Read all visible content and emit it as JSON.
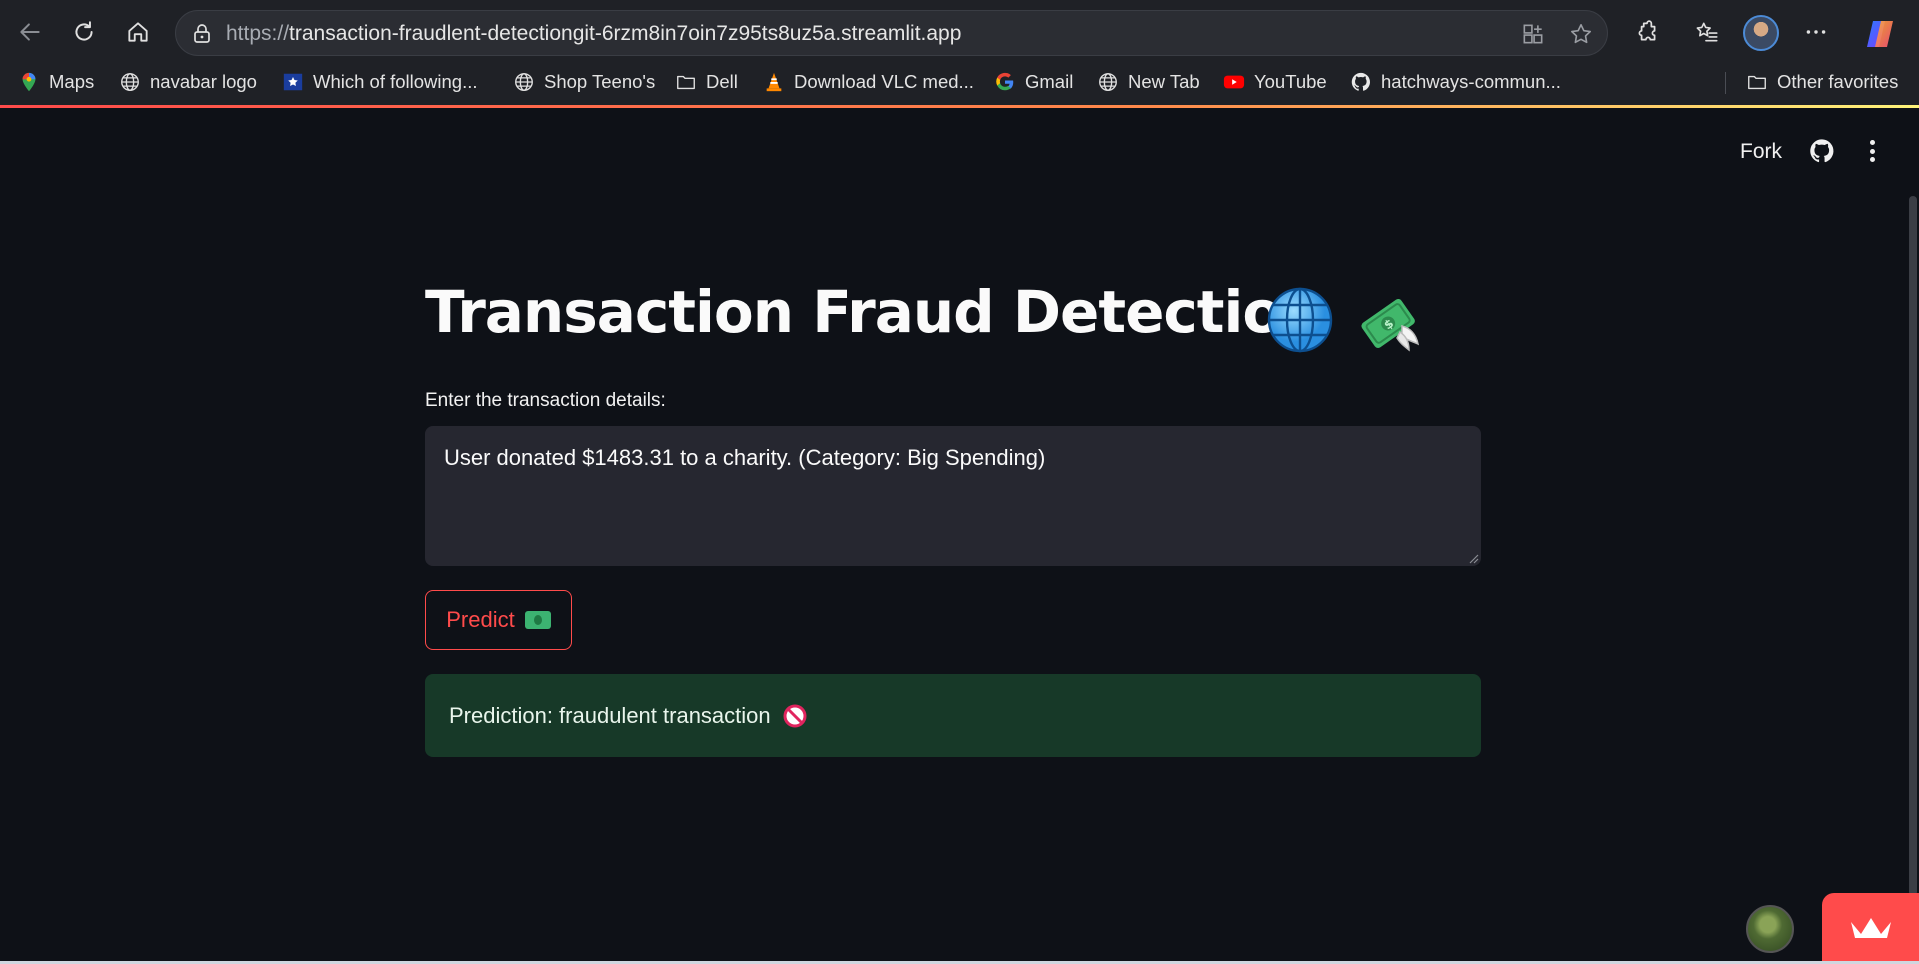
{
  "browser": {
    "url_protocol": "https://",
    "url_rest": "transaction-fraudlent-detectiongit-6rzm8in7oin7z95ts8uz5a.streamlit.app",
    "bookmarks": [
      {
        "label": "Maps",
        "icon": "maps-pin-icon"
      },
      {
        "label": "navabar logo",
        "icon": "globe-icon"
      },
      {
        "label": "Which of following...",
        "icon": "star-flag-icon"
      },
      {
        "label": "Shop Teeno's",
        "icon": "globe-icon"
      },
      {
        "label": "Dell",
        "icon": "folder-icon"
      },
      {
        "label": "Download VLC med...",
        "icon": "vlc-cone-icon"
      },
      {
        "label": "Gmail",
        "icon": "google-icon"
      },
      {
        "label": "New Tab",
        "icon": "globe-icon"
      },
      {
        "label": "YouTube",
        "icon": "youtube-icon"
      },
      {
        "label": "hatchways-commun...",
        "icon": "github-icon"
      }
    ],
    "other_favorites": "Other favorites"
  },
  "app": {
    "fork_label": "Fork",
    "title": "Transaction Fraud Detection",
    "input_label": "Enter the transaction details:",
    "input_value": "User donated $1483.31 to a charity. (Category: Big Spending)",
    "predict_label": "Predict",
    "result_text": "Prediction: fraudulent transaction"
  },
  "colors": {
    "accent": "#ff4b4b",
    "background": "#0e1117",
    "input_bg": "#262730",
    "success_bg": "#173928"
  }
}
